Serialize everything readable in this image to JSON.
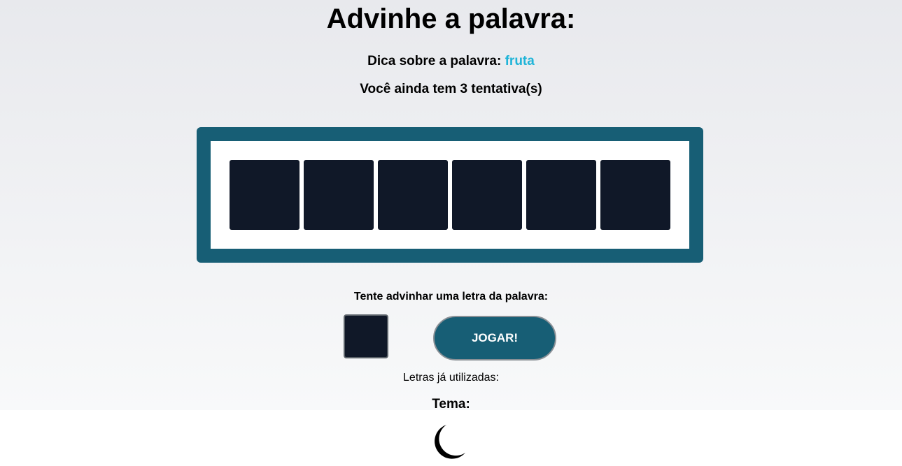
{
  "header": {
    "title": "Advinhe a palavra:",
    "hint_label": "Dica sobre a palavra:",
    "hint_value": "fruta",
    "attempts_text": "Você ainda tem 3 tentativa(s)"
  },
  "board": {
    "letter_count": 6,
    "tiles": [
      "",
      "",
      "",
      "",
      "",
      ""
    ]
  },
  "guess": {
    "label": "Tente advinhar uma letra da palavra:",
    "input_value": "",
    "play_button_label": "JOGAR!"
  },
  "used_letters": {
    "label": "Letras já utilizadas:",
    "letters": ""
  },
  "theme": {
    "label": "Tema:",
    "icon": "moon-icon"
  },
  "colors": {
    "accent": "#175e75",
    "hint": "#1fb4d8",
    "tile": "#101828"
  }
}
